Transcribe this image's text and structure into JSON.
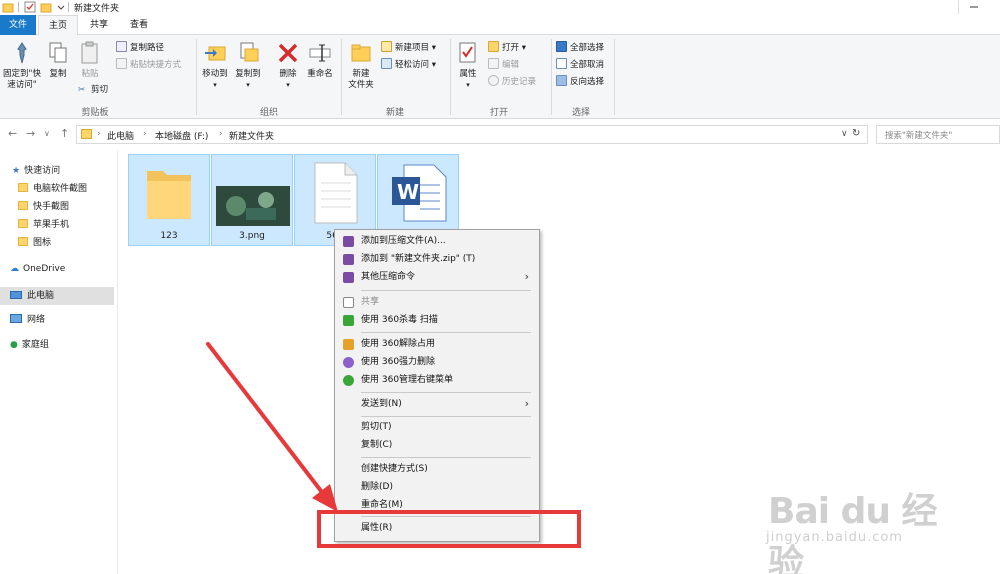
{
  "window": {
    "title": "新建文件夹"
  },
  "tabs": [
    {
      "label": "文件"
    },
    {
      "label": "主页"
    },
    {
      "label": "共享"
    },
    {
      "label": "查看"
    }
  ],
  "ribbon": {
    "clipboard": {
      "pin_label_line1": "固定到\"快",
      "pin_label_line2": "速访问\"",
      "copy": "复制",
      "paste": "粘贴",
      "copy_path": "复制路径",
      "paste_shortcut": "粘贴快捷方式",
      "cut": "剪切",
      "group": "剪贴板"
    },
    "organize": {
      "move_to": "移动到",
      "copy_to": "复制到",
      "delete": "删除",
      "rename": "重命名",
      "group": "组织"
    },
    "new": {
      "new_folder_line1": "新建",
      "new_folder_line2": "文件夹",
      "new_item": "新建项目",
      "easy_access": "轻松访问",
      "group": "新建"
    },
    "open": {
      "properties": "属性",
      "open": "打开",
      "edit": "编辑",
      "history": "历史记录",
      "group": "打开"
    },
    "select": {
      "select_all": "全部选择",
      "select_none": "全部取消",
      "invert": "反向选择",
      "group": "选择"
    }
  },
  "address": {
    "crumbs": [
      "此电脑",
      "本地磁盘 (F:)",
      "新建文件夹"
    ],
    "search_placeholder": "搜索\"新建文件夹\""
  },
  "navpane": {
    "quick_access": "快速访问",
    "quick_items": [
      "电脑软件截图",
      "快手截图",
      "苹果手机",
      "图标"
    ],
    "onedrive": "OneDrive",
    "this_pc": "此电脑",
    "network": "网络",
    "homegroup": "家庭组"
  },
  "files": [
    {
      "name": "123",
      "type": "folder"
    },
    {
      "name": "3.png",
      "type": "image"
    },
    {
      "name": "564",
      "type": "text"
    },
    {
      "name": "",
      "type": "word"
    }
  ],
  "context_menu": {
    "items": [
      {
        "label": "添加到压缩文件(A)...",
        "icon": "winrar-icon"
      },
      {
        "label": "添加到 \"新建文件夹.zip\" (T)",
        "icon": "winrar-icon"
      },
      {
        "label": "其他压缩命令",
        "icon": "winrar-icon",
        "submenu": true
      },
      {
        "label": "共享",
        "icon": "share-icon",
        "dim": true
      },
      {
        "label": "使用 360杀毒 扫描",
        "icon": "shield-icon"
      },
      {
        "label": "使用 360解除占用",
        "icon": "unlock-icon"
      },
      {
        "label": "使用 360强力删除",
        "icon": "shred-icon"
      },
      {
        "label": "使用 360管理右键菜单",
        "icon": "manage-icon"
      },
      {
        "label": "发送到(N)",
        "submenu": true
      },
      {
        "label": "剪切(T)"
      },
      {
        "label": "复制(C)"
      },
      {
        "label": "创建快捷方式(S)"
      },
      {
        "label": "删除(D)"
      },
      {
        "label": "重命名(M)"
      },
      {
        "label": "属性(R)"
      }
    ]
  },
  "watermark": {
    "main": "Bai du 经验",
    "sub": "jingyan.baidu.com"
  },
  "colors": {
    "accent": "#1979ca",
    "selection_fill": "#cce8ff",
    "selection_border": "#99d1ff",
    "annotation": "#e8393a"
  }
}
